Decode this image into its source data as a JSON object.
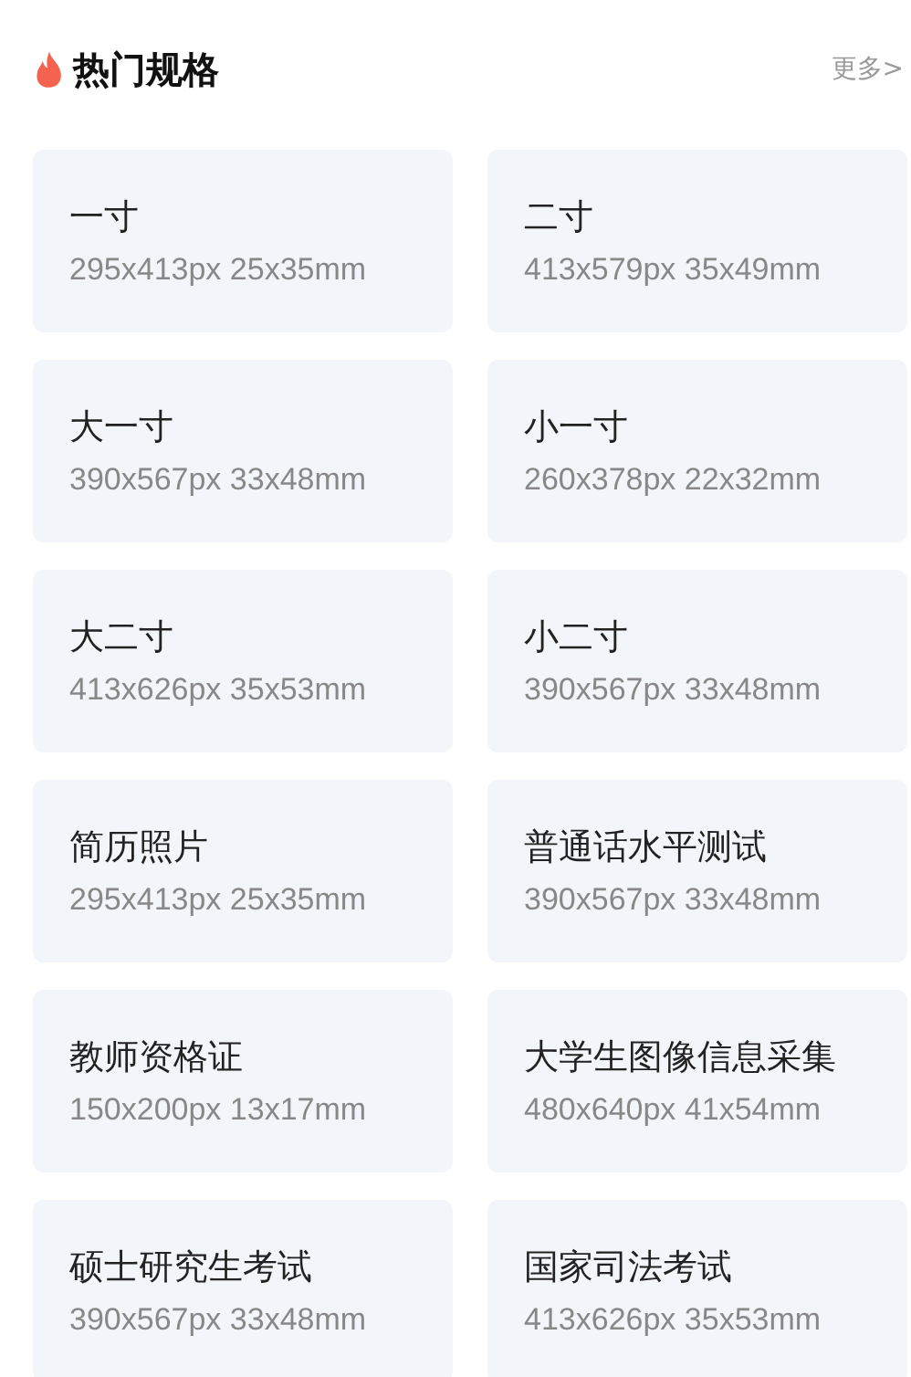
{
  "header": {
    "title": "热门规格",
    "more": "更多>"
  },
  "specs": [
    {
      "name": "一寸",
      "size": "295x413px 25x35mm"
    },
    {
      "name": "二寸",
      "size": "413x579px 35x49mm"
    },
    {
      "name": "大一寸",
      "size": "390x567px 33x48mm"
    },
    {
      "name": "小一寸",
      "size": "260x378px 22x32mm"
    },
    {
      "name": "大二寸",
      "size": "413x626px 35x53mm"
    },
    {
      "name": "小二寸",
      "size": "390x567px 33x48mm"
    },
    {
      "name": "简历照片",
      "size": "295x413px 25x35mm"
    },
    {
      "name": "普通话水平测试",
      "size": "390x567px 33x48mm"
    },
    {
      "name": "教师资格证",
      "size": "150x200px 13x17mm"
    },
    {
      "name": "大学生图像信息采集",
      "size": "480x640px 41x54mm"
    },
    {
      "name": "硕士研究生考试",
      "size": "390x567px 33x48mm"
    },
    {
      "name": "国家司法考试",
      "size": "413x626px 35x53mm"
    }
  ]
}
